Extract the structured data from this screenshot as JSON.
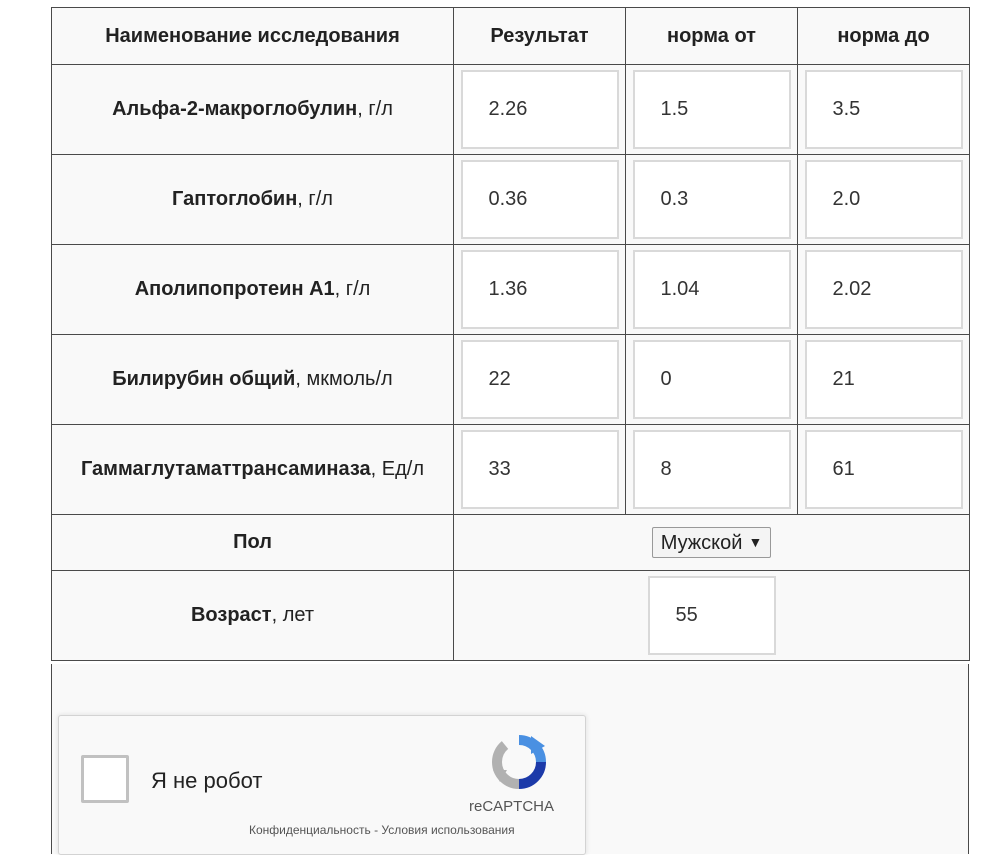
{
  "table": {
    "headers": [
      "Наименование исследования",
      "Результат",
      "норма от",
      "норма до"
    ],
    "rows": [
      {
        "name": "Альфа-2-макроглобулин",
        "unit": ", г/л",
        "result": "2.26",
        "min": "1.5",
        "max": "3.5"
      },
      {
        "name": "Гаптоглобин",
        "unit": ", г/л",
        "result": "0.36",
        "min": "0.3",
        "max": "2.0"
      },
      {
        "name": "Аполипопротеин А1",
        "unit": ", г/л",
        "result": "1.36",
        "min": "1.04",
        "max": "2.02"
      },
      {
        "name": "Билирубин общий",
        "unit": ", мкмоль/л",
        "result": "22",
        "min": "0",
        "max": "21"
      },
      {
        "name": "Гаммаглутаматтрансаминаза",
        "unit": ", Ед/л",
        "result": "33",
        "min": "8",
        "max": "61"
      }
    ]
  },
  "sex": {
    "label": "Пол",
    "value": "Мужской"
  },
  "age": {
    "label": "Возраст",
    "unit": ", лет",
    "value": "55"
  },
  "captcha": {
    "label": "Я не робот",
    "brand": "reCAPTCHA",
    "privacy": "Конфиденциальность",
    "separator": " - ",
    "terms": "Условия использования",
    "colors": {
      "blue": "#4a90e2",
      "dark_blue": "#1c3aa9",
      "gray": "#b1b1b1"
    }
  }
}
